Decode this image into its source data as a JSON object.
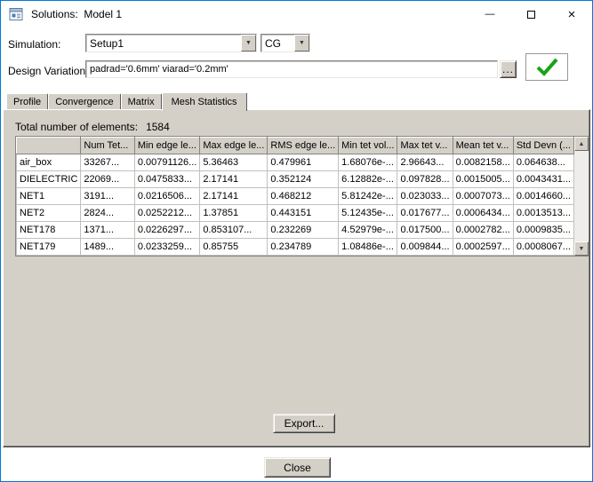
{
  "window": {
    "title": "Solutions:  Model 1"
  },
  "titlebar_icons": {
    "minimize": "—",
    "maximize": "",
    "close": "×"
  },
  "colors": {
    "accent_border": "#0078d7",
    "panel_gray": "#d4d0c8",
    "check_green": "#17a317"
  },
  "icons": {
    "dropdown": "▼",
    "scroll_up": "▲",
    "scroll_down": "▼"
  },
  "simulation": {
    "label": "Simulation:",
    "value": "Setup1"
  },
  "solution_type": {
    "value": "CG"
  },
  "design_variation": {
    "label": "Design Variation:",
    "value": "padrad='0.6mm' viarad='0.2mm'",
    "browse_label": "..."
  },
  "tabs": [
    {
      "label": "Profile",
      "active": false
    },
    {
      "label": "Convergence",
      "active": false
    },
    {
      "label": "Matrix",
      "active": false
    },
    {
      "label": "Mesh Statistics",
      "active": true
    }
  ],
  "mesh": {
    "total_label": "Total number of elements:",
    "total_value": "1584",
    "table": {
      "headers": [
        "",
        "Num Tet...",
        "Min edge le...",
        "Max edge le...",
        "RMS edge le...",
        "Min tet vol...",
        "Max tet v...",
        "Mean tet v...",
        "Std Devn (..."
      ],
      "rows": [
        [
          "air_box",
          "33267...",
          "0.00791126...",
          "5.36463",
          "0.479961",
          "1.68076e-...",
          "2.96643...",
          "0.0082158...",
          "0.064638..."
        ],
        [
          "DIELECTRIC",
          "22069...",
          "0.0475833...",
          "2.17141",
          "0.352124",
          "6.12882e-...",
          "0.097828...",
          "0.0015005...",
          "0.0043431..."
        ],
        [
          "NET1",
          "3191...",
          "0.0216506...",
          "2.17141",
          "0.468212",
          "5.81242e-...",
          "0.023033...",
          "0.0007073...",
          "0.0014660..."
        ],
        [
          "NET2",
          "2824...",
          "0.0252212...",
          "1.37851",
          "0.443151",
          "5.12435e-...",
          "0.017677...",
          "0.0006434...",
          "0.0013513..."
        ],
        [
          "NET178",
          "1371...",
          "0.0226297...",
          "0.853107...",
          "0.232269",
          "4.52979e-...",
          "0.017500...",
          "0.0002782...",
          "0.0009835..."
        ],
        [
          "NET179",
          "1489...",
          "0.0233259...",
          "0.85755",
          "0.234789",
          "1.08486e-...",
          "0.009844...",
          "0.0002597...",
          "0.0008067..."
        ]
      ]
    },
    "export_label": "Export..."
  },
  "footer": {
    "close_label": "Close"
  }
}
